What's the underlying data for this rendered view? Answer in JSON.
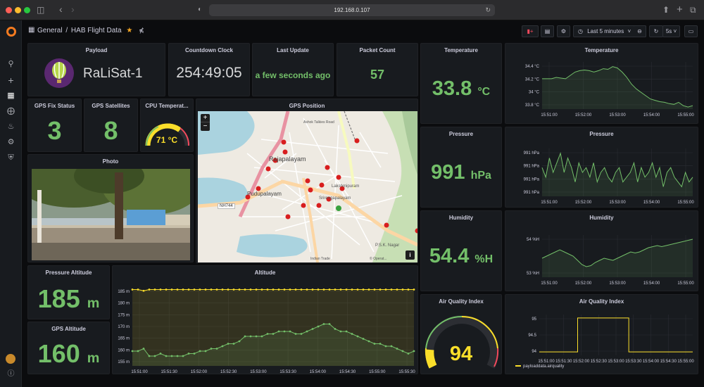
{
  "browser": {
    "url": "192.168.0.107"
  },
  "breadcrumb": {
    "folder": "General",
    "separator": "/",
    "title": "HAB Flight Data"
  },
  "toolbar": {
    "time_range": "Last 5 minutes",
    "refresh": "5s"
  },
  "panels": {
    "payload": {
      "title": "Payload",
      "name": "RaLiSat-1"
    },
    "countdown": {
      "title": "Countdown Clock",
      "value": "254:49:05"
    },
    "last_update": {
      "title": "Last Update",
      "value": "a few seconds ago"
    },
    "packet_count": {
      "title": "Packet Count",
      "value": "57"
    },
    "gps_fix": {
      "title": "GPS Fix Status",
      "value": "3"
    },
    "gps_sat": {
      "title": "GPS Satellites",
      "value": "8"
    },
    "cpu_temp": {
      "title": "CPU Temperat...",
      "value": "71 °C",
      "fraction": 0.71
    },
    "gps_position": {
      "title": "GPS Position",
      "zoom_in": "+",
      "zoom_out": "−",
      "info": "i",
      "labels": {
        "rajapalayam": "Rajapalayam",
        "pudupalayam": "Pudupalayam",
        "lakshmipuram": "Lakshmipuram",
        "srirengapalayam": "Srirengapalayam",
        "psk": "P.S.K. Nagar",
        "nh744": "NH744",
        "road": "Ashok Talkies Road",
        "indian": "Indian Trade",
        "osm": "© Operat..."
      }
    },
    "photo": {
      "title": "Photo"
    },
    "pressure_altitude": {
      "title": "Pressure Altitude",
      "value": "185",
      "unit": "m"
    },
    "gps_altitude": {
      "title": "GPS Altitude",
      "value": "160",
      "unit": "m"
    },
    "altitude": {
      "title": "Altitude"
    },
    "temperature_stat": {
      "title": "Temperature",
      "value": "33.8",
      "unit": "°C"
    },
    "pressure_stat": {
      "title": "Pressure",
      "value": "991",
      "unit": "hPa"
    },
    "humidity_stat": {
      "title": "Humidity",
      "value": "54.4",
      "unit": "%H"
    },
    "aqi_stat": {
      "title": "Air Quality Index",
      "value": "94"
    },
    "temperature_chart": {
      "title": "Temperature"
    },
    "pressure_chart": {
      "title": "Pressure"
    },
    "humidity_chart": {
      "title": "Humidity"
    },
    "aqi_chart": {
      "title": "Air Quality Index",
      "legend": "payloaddata.airquality"
    }
  },
  "colors": {
    "green": "#73bf69",
    "yellow": "#fade2a",
    "red": "#f2495c",
    "orange": "#ff9830"
  },
  "chart_data": [
    {
      "type": "line",
      "title": "Temperature",
      "x": [
        "15:51:00",
        "15:52:00",
        "15:53:00",
        "15:54:00",
        "15:55:00"
      ],
      "yticks": [
        "34.4 °C",
        "34.2 °C",
        "34 °C",
        "33.8 °C"
      ],
      "ylim": [
        33.75,
        34.45
      ],
      "values": [
        34.2,
        34.2,
        34.2,
        34.22,
        34.21,
        34.2,
        34.25,
        34.3,
        34.32,
        34.33,
        34.32,
        34.3,
        34.32,
        34.35,
        34.34,
        34.38,
        34.36,
        34.3,
        34.22,
        34.12,
        34.05,
        34.0,
        33.95,
        33.9,
        33.88,
        33.86,
        33.85,
        33.83,
        33.82,
        33.85,
        33.8,
        33.78,
        33.8
      ]
    },
    {
      "type": "line",
      "title": "Pressure",
      "x": [
        "15:51:00",
        "15:52:00",
        "15:53:00",
        "15:54:00",
        "15:55:00"
      ],
      "yticks": [
        "991 hPa",
        "991 hPa",
        "991 hPa",
        "991 hPa"
      ],
      "ylim": [
        990.5,
        991.5
      ],
      "values": [
        991.1,
        990.9,
        991.3,
        991.0,
        991.2,
        991.4,
        991.0,
        991.3,
        991.1,
        990.8,
        991.2,
        991.0,
        991.1,
        990.9,
        991.2,
        990.8,
        991.0,
        991.1,
        990.9,
        990.8,
        991.0,
        991.1,
        990.8,
        990.9,
        991.0,
        991.2,
        990.8,
        991.1,
        990.9,
        991.0,
        991.2,
        990.9,
        991.1,
        990.7,
        991.0,
        991.1,
        990.9,
        990.8,
        990.7,
        991.0,
        990.8,
        990.9
      ]
    },
    {
      "type": "line",
      "title": "Humidity",
      "x": [
        "15:51:00",
        "15:52:00",
        "15:53:00",
        "15:54:00",
        "15:55:00"
      ],
      "yticks": [
        "54 %H",
        "53 %H"
      ],
      "ylim": [
        52.6,
        54.6
      ],
      "values": [
        53.5,
        53.6,
        53.7,
        53.8,
        53.9,
        53.8,
        53.7,
        53.6,
        53.4,
        53.2,
        53.1,
        53.15,
        53.3,
        53.4,
        53.5,
        53.45,
        53.4,
        53.5,
        53.6,
        53.7,
        53.8,
        53.75,
        53.8,
        53.9,
        54.0,
        54.05,
        54.1,
        54.05,
        54.1,
        54.15,
        54.2,
        54.25,
        54.3,
        54.35,
        54.4
      ]
    },
    {
      "type": "line",
      "title": "Air Quality Index",
      "x": [
        "15:51:00",
        "15:51:30",
        "15:52:00",
        "15:52:30",
        "15:53:00",
        "15:53:30",
        "15:54:00",
        "15:54:30",
        "15:55:00"
      ],
      "yticks": [
        "95",
        "94.5",
        "94"
      ],
      "ylim": [
        93.9,
        95.1
      ],
      "series": [
        {
          "name": "payloaddata.airquality",
          "values": [
            94,
            94,
            94,
            95,
            95,
            95,
            95,
            94,
            94,
            94,
            94,
            94,
            94
          ]
        }
      ]
    },
    {
      "type": "line",
      "title": "Altitude",
      "x": [
        "15:51:00",
        "15:51:30",
        "15:52:00",
        "15:52:30",
        "15:53:00",
        "15:53:30",
        "15:54:00",
        "15:54:30",
        "15:55:00",
        "15:55:30"
      ],
      "yticks": [
        "185 m",
        "180 m",
        "175 m",
        "170 m",
        "165 m",
        "160 m",
        "155 m"
      ],
      "ylim": [
        154,
        186
      ],
      "series": [
        {
          "name": "Pressure Altitude",
          "values": [
            185,
            185,
            184.5,
            185,
            185,
            185,
            185,
            185,
            185,
            185,
            185,
            185,
            185,
            185,
            185,
            185,
            185,
            185,
            185,
            185,
            185,
            185,
            185,
            185,
            185,
            185,
            185,
            185,
            185,
            185,
            185,
            185,
            185,
            185,
            185,
            185,
            185,
            185,
            185,
            185,
            185,
            185,
            185,
            185,
            185,
            185,
            185,
            185,
            185,
            185,
            185
          ]
        },
        {
          "name": "GPS Altitude",
          "values": [
            160,
            160,
            161,
            158,
            158,
            159,
            158,
            158,
            158,
            158,
            159,
            159,
            160,
            160,
            161,
            161,
            162,
            163,
            163,
            164,
            166,
            166,
            166,
            166,
            167,
            167,
            168,
            168,
            168,
            167,
            167,
            168,
            169,
            170,
            171,
            171,
            169,
            168,
            168,
            167,
            166,
            165,
            164,
            163,
            163,
            162,
            162,
            161,
            160,
            159,
            160
          ]
        }
      ]
    }
  ]
}
